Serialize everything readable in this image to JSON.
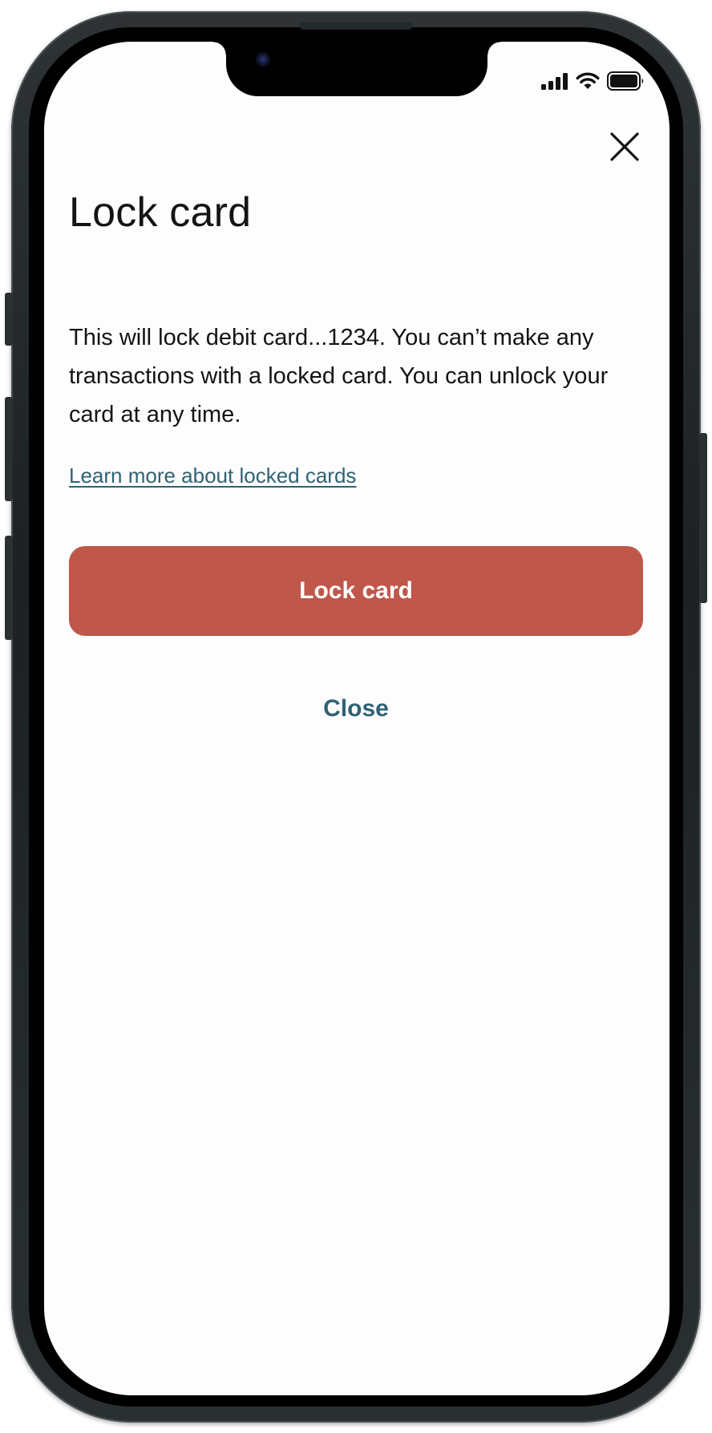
{
  "status_bar": {
    "icons": [
      "signal-icon",
      "wifi-icon",
      "battery-icon"
    ]
  },
  "modal": {
    "close_icon": "close-icon",
    "title": "Lock card",
    "description": "This will lock debit card...1234. You can’t make any transactions with a locked card. You can unlock your card at any time.",
    "learn_more_link": "Learn more about locked cards",
    "primary_button": "Lock card",
    "secondary_button": "Close"
  },
  "colors": {
    "primary_button": "#bf574a",
    "link": "#2f6274",
    "text": "#141414",
    "screen_background": "#fdfdfd"
  }
}
